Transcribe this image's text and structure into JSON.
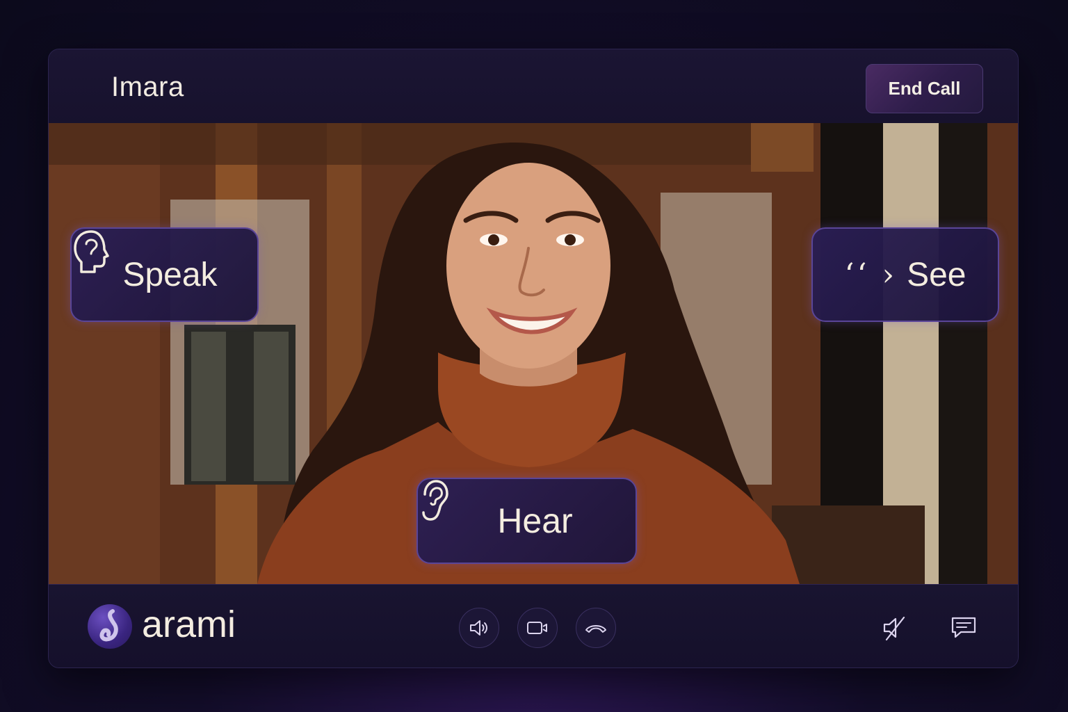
{
  "header": {
    "contact_name": "Imara",
    "end_call_label": "End Call"
  },
  "overlay": {
    "speak_label": "Speak",
    "see_glyph": "‘‘ ›",
    "see_label": "See",
    "hear_label": "Hear"
  },
  "footer": {
    "brand_name": "arami",
    "controls": [
      "speaker-icon",
      "camera-icon",
      "hang-up-icon",
      "mute-icon",
      "chat-icon"
    ]
  },
  "colors": {
    "background": "#0c0a1c",
    "panel": "#17122e",
    "accent_border": "#5a4598",
    "text": "#f4ede0"
  }
}
